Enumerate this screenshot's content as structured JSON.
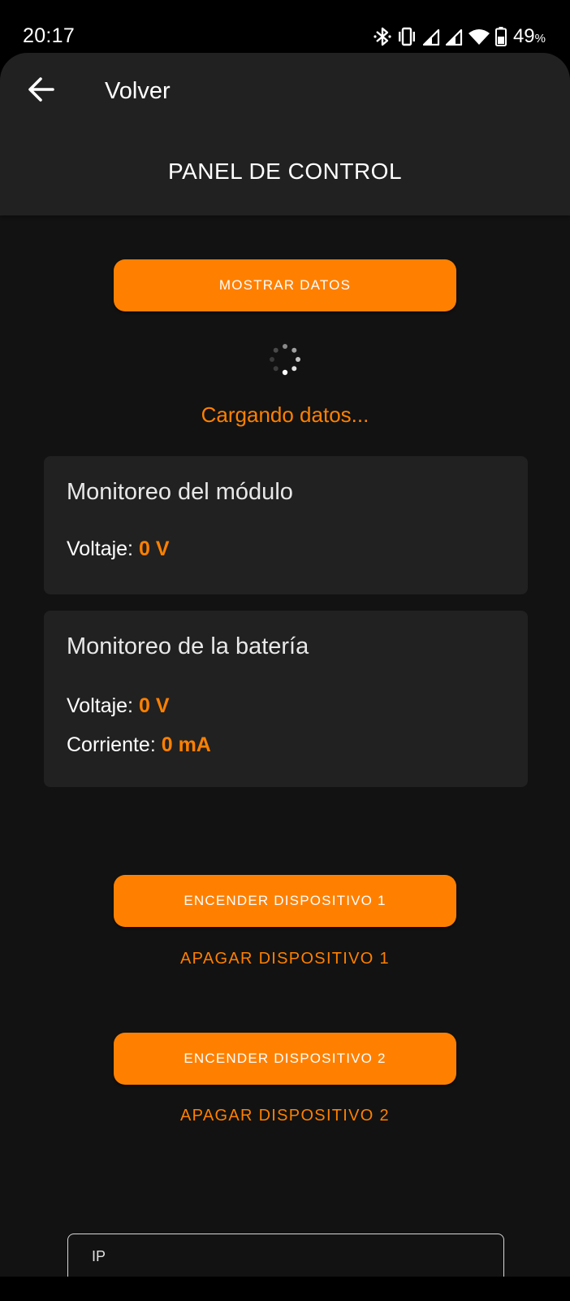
{
  "status_bar": {
    "time": "20:17",
    "battery_percent": "49",
    "battery_percent_sign": "%",
    "icons": [
      "bluetooth-icon",
      "vibrate-icon",
      "signal-icon",
      "signal-icon",
      "wifi-icon",
      "battery-icon"
    ]
  },
  "header": {
    "back_icon": "arrow-left-icon",
    "back_label": "Volver",
    "title": "PANEL DE CONTROL"
  },
  "actions": {
    "show_data_label": "MOSTRAR DATOS",
    "loading_text": "Cargando datos...",
    "device1_on_label": "ENCENDER DISPOSITIVO 1",
    "device1_off_label": "APAGAR DISPOSITIVO 1",
    "device2_on_label": "ENCENDER DISPOSITIVO 2",
    "device2_off_label": "APAGAR DISPOSITIVO 2"
  },
  "module_card": {
    "title": "Monitoreo del módulo",
    "voltage_label": "Voltaje:",
    "voltage_value": "0 V"
  },
  "battery_card": {
    "title": "Monitoreo de la batería",
    "voltage_label": "Voltaje:",
    "voltage_value": "0 V",
    "current_label": "Corriente:",
    "current_value": "0 mA"
  },
  "ip_input": {
    "label": "IP",
    "value": ""
  },
  "colors": {
    "accent": "#ff8000",
    "background": "#121212",
    "surface": "#212121",
    "text": "#ffffff"
  }
}
